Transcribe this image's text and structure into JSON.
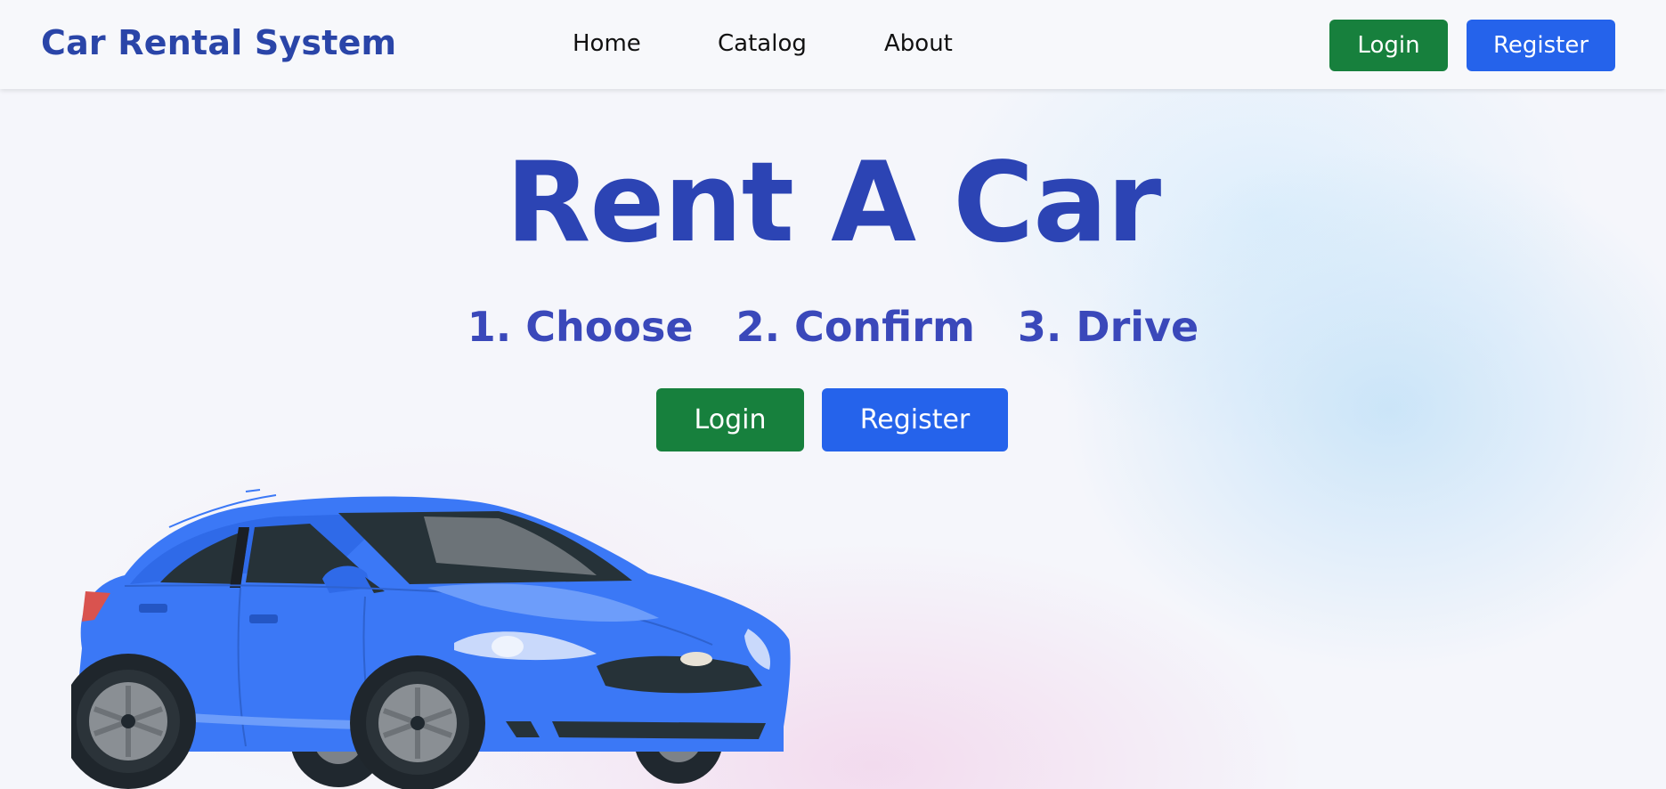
{
  "navbar": {
    "brand": "Car Rental System",
    "links": [
      {
        "label": "Home"
      },
      {
        "label": "Catalog"
      },
      {
        "label": "About"
      }
    ],
    "login_label": "Login",
    "register_label": "Register"
  },
  "hero": {
    "title": "Rent A Car",
    "steps": [
      "1. Choose",
      "2. Confirm",
      "3. Drive"
    ],
    "login_label": "Login",
    "register_label": "Register"
  },
  "colors": {
    "brand_blue": "#2a45a8",
    "login_green": "#17803d",
    "register_blue": "#2563eb",
    "car_blue": "#3b78f6"
  },
  "illustration": {
    "icon": "blue-sedan-car-icon"
  }
}
